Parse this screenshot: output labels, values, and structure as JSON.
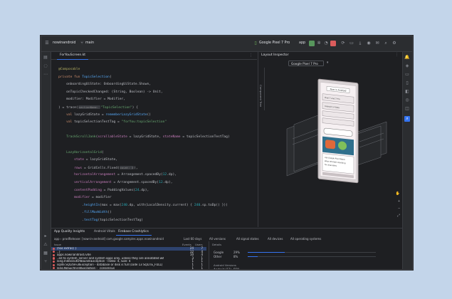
{
  "toolbar": {
    "project": "nowinandroid",
    "branch": "main",
    "device": "Google Pixel 7 Pro",
    "run_config": "app"
  },
  "editor": {
    "tab": "ForYouScreen.kt",
    "lines": [
      [
        {
          "t": "@Composable",
          "c": "a"
        }
      ],
      [
        {
          "t": "private fun ",
          "c": "k"
        },
        {
          "t": "TopicSelection",
          "c": "f"
        },
        {
          "t": "(",
          "c": ""
        }
      ],
      [
        {
          "t": "    onboardingUiState: OnboardingUiState.Shown,",
          "c": ""
        }
      ],
      [
        {
          "t": "    onTopicCheckedChanged: (String, Boolean) -> Unit,",
          "c": ""
        }
      ],
      [
        {
          "t": "    modifier: Modifier = Modifier,",
          "c": ""
        }
      ],
      [
        {
          "t": ") = trace(",
          "c": ""
        },
        {
          "t": "sectionName: ",
          "c": "hint"
        },
        {
          "t": "\"TopicSelection\"",
          "c": "s"
        },
        {
          "t": ") {",
          "c": ""
        }
      ],
      [
        {
          "t": "    val ",
          "c": "k"
        },
        {
          "t": "lazyGridState = ",
          "c": ""
        },
        {
          "t": "rememberLazyGridState",
          "c": "f"
        },
        {
          "t": "()",
          "c": ""
        }
      ],
      [
        {
          "t": "    val ",
          "c": "k"
        },
        {
          "t": "topicSelectionTestTag = ",
          "c": ""
        },
        {
          "t": "\"forYou:topicSelection\"",
          "c": "s"
        }
      ],
      [
        {
          "t": "",
          "c": ""
        }
      ],
      [
        {
          "t": "    TrackScrollJank",
          "c": "s"
        },
        {
          "t": "(",
          "c": ""
        },
        {
          "t": "scrollableState",
          "c": "p"
        },
        {
          "t": " = lazyGridState, ",
          "c": ""
        },
        {
          "t": "stateName",
          "c": "p"
        },
        {
          "t": " = topicSelectionTestTag)",
          "c": ""
        }
      ],
      [
        {
          "t": "",
          "c": ""
        }
      ],
      [
        {
          "t": "    LazyHorizontalGrid",
          "c": "s"
        },
        {
          "t": "(",
          "c": ""
        }
      ],
      [
        {
          "t": "        state",
          "c": "p"
        },
        {
          "t": " = lazyGridState,",
          "c": ""
        }
      ],
      [
        {
          "t": "        rows",
          "c": "p"
        },
        {
          "t": " = GridCells.Fixed(",
          "c": ""
        },
        {
          "t": "count: 3",
          "c": "hint"
        },
        {
          "t": "),",
          "c": ""
        }
      ],
      [
        {
          "t": "        horizontalArrangement",
          "c": "p"
        },
        {
          "t": " = Arrangement.spacedBy(",
          "c": ""
        },
        {
          "t": "12",
          "c": "n"
        },
        {
          "t": ".dp),",
          "c": ""
        }
      ],
      [
        {
          "t": "        verticalArrangement",
          "c": "p"
        },
        {
          "t": " = Arrangement.spacedBy(",
          "c": ""
        },
        {
          "t": "12",
          "c": "n"
        },
        {
          "t": ".dp),",
          "c": ""
        }
      ],
      [
        {
          "t": "        contentPadding",
          "c": "p"
        },
        {
          "t": " = PaddingValues(",
          "c": ""
        },
        {
          "t": "24",
          "c": "n"
        },
        {
          "t": ".dp),",
          "c": ""
        }
      ],
      [
        {
          "t": "        modifier",
          "c": "p"
        },
        {
          "t": " = modifier",
          "c": ""
        }
      ],
      [
        {
          "t": "            .",
          "c": ""
        },
        {
          "t": "heightIn",
          "c": "f"
        },
        {
          "t": "(max = max(",
          "c": ""
        },
        {
          "t": "240",
          "c": "n"
        },
        {
          "t": ".dp, with(LocalDensity.current) { ",
          "c": ""
        },
        {
          "t": "240",
          "c": "n"
        },
        {
          "t": ".sp.toDp() }))",
          "c": ""
        }
      ],
      [
        {
          "t": "            .",
          "c": ""
        },
        {
          "t": "fillMaxWidth",
          "c": "f"
        },
        {
          "t": "()",
          "c": ""
        }
      ],
      [
        {
          "t": "            .",
          "c": ""
        },
        {
          "t": "testTag",
          "c": "f"
        },
        {
          "t": "(topicSelectionTestTag)",
          "c": ""
        }
      ]
    ]
  },
  "layout_inspector": {
    "title": "Layout Inspector",
    "device": "Google Pixel 7 Pro",
    "side_label": "Component Tree",
    "preview": {
      "heading": "Now in Android",
      "news_line1": "Pixel 7 and 7 Pro",
      "news_line2": "Android 14 Beta",
      "card_line1": "Hot Google Pixel Watch",
      "card_line2": "Wear OS Kotlin Building",
      "card_line3": "for wearables"
    }
  },
  "aqi": {
    "tabs": [
      "App Quality Insights",
      "Android Vitals",
      "Firebase Crashlytics"
    ],
    "filter_app": "app › prodRelease: [now-in-android] com.google.samples.apps.nowinandroid",
    "filter_time": "Last 60 days",
    "filter_versions": "All versions",
    "filter_signals": "All signal states",
    "filter_devices": "All devices",
    "filter_os": "All operating systems",
    "headers": {
      "issue": "Issue",
      "events": "Events",
      "users": "Users",
      "details": "Details"
    },
    "issues": [
      {
        "title": "(has extras) }",
        "events": "24",
        "users": "7",
        "selected": true
      },
      {
        "title": "..}",
        "events": "12",
        "users": "4",
        "selected": false
      },
      {
        "title": "apps.nowinandroid.iv0e",
        "events": "10",
        "users": "4",
        "selected": false
      },
      {
        "title": "..ed to system_server and system apps only, unless they are annotated with @Readable.",
        "events": "3",
        "users": "1",
        "selected": false
      },
      {
        "title": "lang.IndexOutOfBoundsException - Index: 4, Size: 4",
        "events": "1",
        "users": "1",
        "selected": false
      },
      {
        "title": "sqlite.SQLiteFullException - database or disk is full (code 13 SQLITE_FULL)",
        "events": "1",
        "users": "1",
        "selected": false
      },
      {
        "title": "lang.NoSuchFieldException - _consensus",
        "events": "1",
        "users": "1",
        "selected": false
      }
    ],
    "details": {
      "devices": [
        {
          "name": "Google",
          "pct": "29%",
          "v": 0.29
        },
        {
          "name": "Other",
          "pct": "8%",
          "v": 0.08
        }
      ],
      "android_label": "Android Versions",
      "versions": [
        {
          "name": "Android (12)",
          "pct": "55%",
          "v": 0.55
        },
        {
          "name": "Android (13)",
          "pct": "25%",
          "v": 0.25
        },
        {
          "name": "Android (9)",
          "pct": "8%",
          "v": 0.08
        },
        {
          "name": "Other",
          "pct": "8%",
          "v": 0.08
        }
      ]
    }
  }
}
